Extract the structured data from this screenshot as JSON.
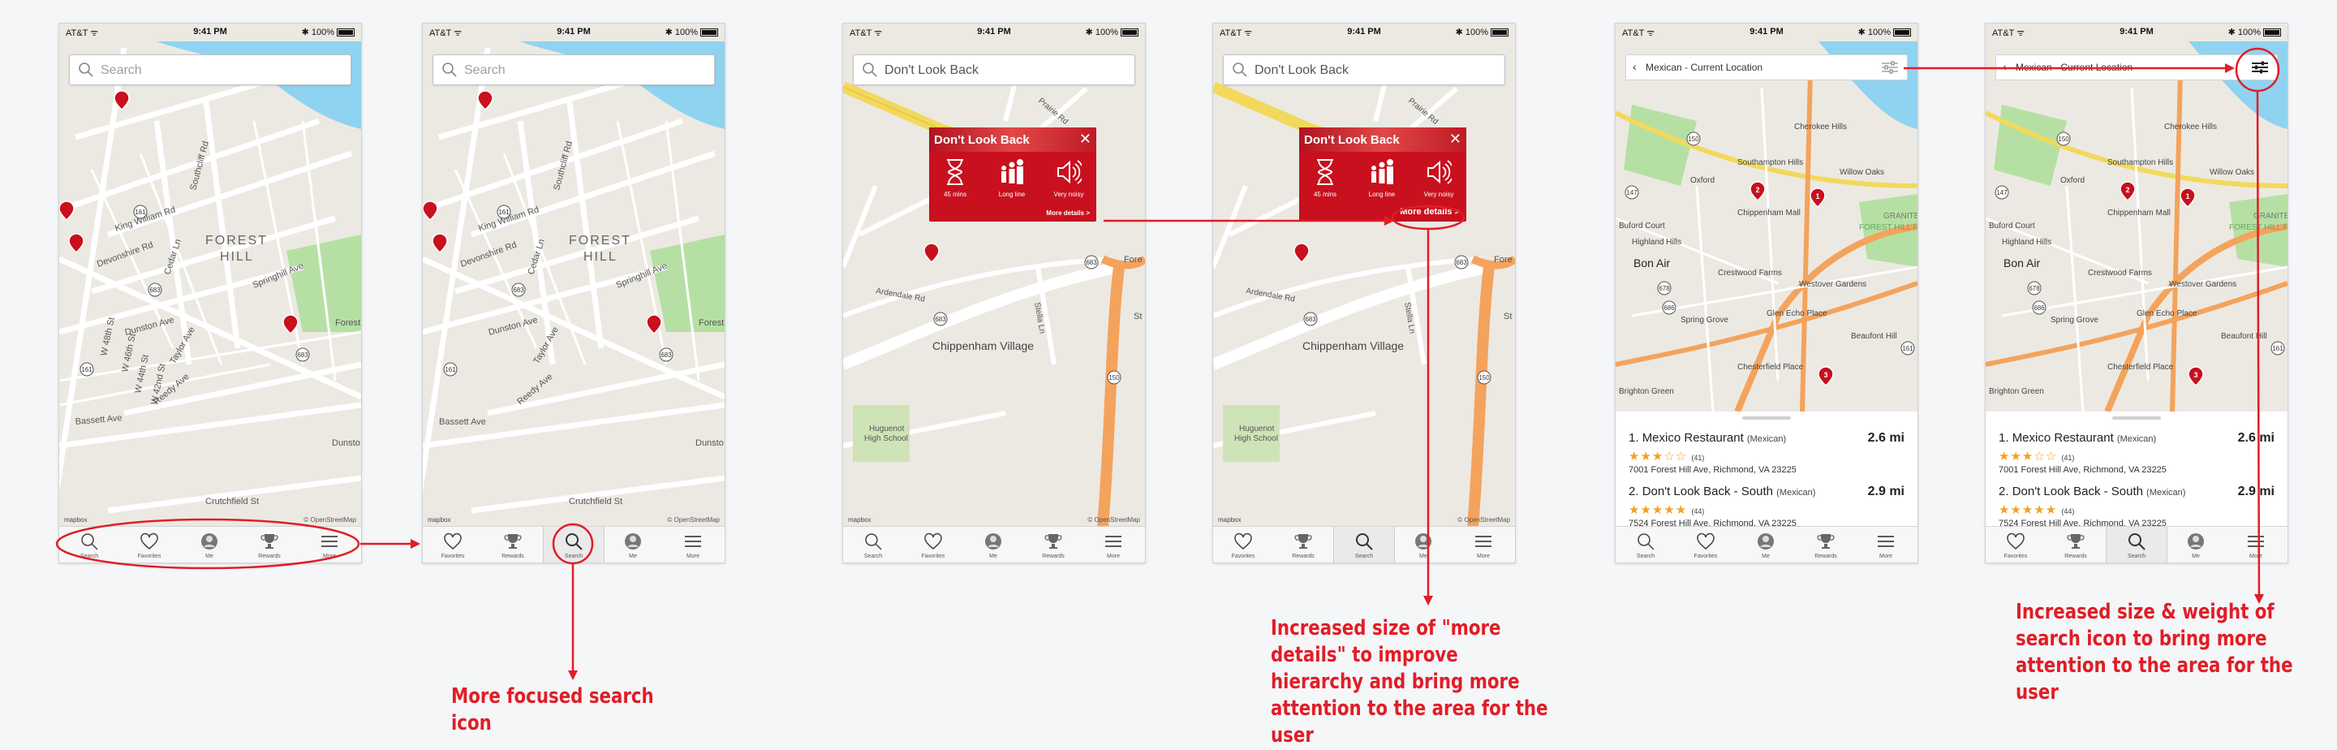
{
  "status": {
    "carrier": "AT&T",
    "time": "9:41 PM",
    "battery": "100%"
  },
  "search": {
    "placeholder": "Search",
    "query": "Don't Look Back"
  },
  "header": {
    "title": "Mexican - Current Location"
  },
  "map": {
    "labels_forest": [
      "FOREST",
      "HILL",
      "King William Rd",
      "Devonshire Rd",
      "Southcliff Rd",
      "Cedar Ln",
      "Springhill Ave",
      "Dunston Ave",
      "Taylor Ave",
      "Reedy Ave",
      "Bassett Ave",
      "W 48th St",
      "W 46th St",
      "W 44th St",
      "W 42nd St",
      "Dunsto",
      "Forest",
      "Crutchfield St",
      "161",
      "683"
    ],
    "labels_chip": [
      "Chippenham Village",
      "Huguenot",
      "High School",
      "Ardendale Rd",
      "Prairie Rd",
      "Stella Ln",
      "683",
      "150",
      "Fore",
      "St"
    ],
    "labels_bon": [
      "Bon Air",
      "Oxford",
      "Southampton Hills",
      "Chippenham Mall",
      "Cherokee Hills",
      "Willow Oaks",
      "Highland Hills",
      "Buford Court",
      "Crestwood Farms",
      "Westover Gardens",
      "Glen Echo Place",
      "Spring Grove",
      "Beaufont Hill",
      "Chesterfield Place",
      "Brighton Green",
      "FOREST HILL FARMS",
      "GRANITE",
      "150",
      "147",
      "678",
      "686",
      "161",
      "1",
      "2",
      "3"
    ],
    "attribution": "mapbox",
    "copyright": "© OpenStreetMap"
  },
  "tabs_original": [
    {
      "icon": "search-icon",
      "label": "Search"
    },
    {
      "icon": "heart-icon",
      "label": "Favorites"
    },
    {
      "icon": "person-icon",
      "label": "Me"
    },
    {
      "icon": "trophy-icon",
      "label": "Rewards"
    },
    {
      "icon": "menu-icon",
      "label": "More"
    }
  ],
  "tabs_revised": [
    {
      "icon": "heart-icon",
      "label": "Favorites"
    },
    {
      "icon": "trophy-icon",
      "label": "Rewards"
    },
    {
      "icon": "search-icon",
      "label": "Search"
    },
    {
      "icon": "person-icon",
      "label": "Me"
    },
    {
      "icon": "menu-icon",
      "label": "More"
    }
  ],
  "popup": {
    "title": "Don't Look Back",
    "metrics": [
      {
        "icon": "hourglass-icon",
        "label": "45 mins"
      },
      {
        "icon": "crowd-icon",
        "label": "Long line"
      },
      {
        "icon": "speaker-icon",
        "label": "Very noisy"
      }
    ],
    "more": "More details >"
  },
  "results": [
    {
      "rank": "1.",
      "name": "Mexico Restaurant",
      "cuisine": "(Mexican)",
      "distance": "2.6 mi",
      "rating": 3,
      "reviews": "(41)",
      "address": "7001 Forest Hill Ave, Richmond, VA 23225"
    },
    {
      "rank": "2.",
      "name": "Don't Look Back - South",
      "cuisine": "(Mexican)",
      "distance": "2.9 mi",
      "rating": 5,
      "reviews": "(44)",
      "address": "7524 Forest Hill Ave, Richmond, VA 23225"
    }
  ],
  "annotations": {
    "search": "More focused search icon",
    "details": "Increased size of \"more details\" to improve hierarchy and bring more attention to the area for the user",
    "filter": "Increased size & weight of search icon to bring more attention to the area for the user"
  },
  "colors": {
    "accent": "#e11d26",
    "water": "#8fd3f0",
    "park": "#b6e0a3",
    "road_major": "#f4a35c",
    "road_minor": "#ffffff",
    "land": "#ece9e3"
  }
}
